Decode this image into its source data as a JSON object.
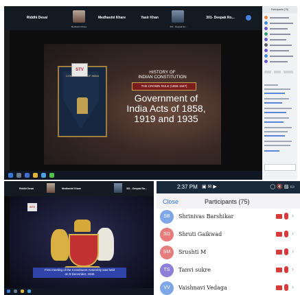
{
  "top_call": {
    "participants": [
      {
        "name": "Riddhi Desai",
        "has_photo": false
      },
      {
        "name": "",
        "has_photo": true,
        "caption": "Medhavini Khare"
      },
      {
        "name": "Medhavini Khare",
        "has_photo": false
      },
      {
        "name": "Yasir Khan",
        "has_photo": false
      },
      {
        "name": "",
        "has_photo": true,
        "caption": "301 - Deepak Ro..."
      },
      {
        "name": "301- Deepak Ro...",
        "has_photo": false
      }
    ],
    "slide": {
      "logo": "STV",
      "book_title": "CONSTITUTION OF INDIA",
      "history_line1": "HISTORY OF",
      "history_line2": "INDIAN CONSTITUTION",
      "crown_rule": "THE CROWN RULE (1858-1947)",
      "main_title": "Government of India Acts of 1858, 1919 and 1935"
    },
    "panel_header": "Participants (75)",
    "colors": {
      "accent": "#2f6fd8",
      "bar": "#141a21"
    }
  },
  "bottom_left_call": {
    "participants": [
      "Riddhi Desai",
      "Medhavini Khare",
      "301 - Deepak Ro..."
    ],
    "slide": {
      "logo": "STV",
      "caption_line1": "First meeting of the Constituent Assembly was held",
      "caption_line2": "on 9 December, 1946"
    }
  },
  "phone": {
    "time": "2:37 PM",
    "status_icons": "▣ ✉ ▶",
    "status_right": "◯ 🔇 ▨ ▭",
    "close_label": "Close",
    "title": "Participants (75)",
    "participants": [
      {
        "initials": "SB",
        "name": "Shrinivas Barshikar",
        "color": "#7fa6e6"
      },
      {
        "initials": "SG",
        "name": "Shruti Gaikwad",
        "color": "#e87c7c"
      },
      {
        "initials": "SM",
        "name": "Srushti M",
        "color": "#e87c7c"
      },
      {
        "initials": "TS",
        "name": "Tanvi sukre",
        "color": "#8e7fd9"
      },
      {
        "initials": "VV",
        "name": "Vaishnavi Vedaga",
        "color": "#7fa6e6"
      }
    ],
    "colors": {
      "muted": "#d93a3a"
    }
  }
}
